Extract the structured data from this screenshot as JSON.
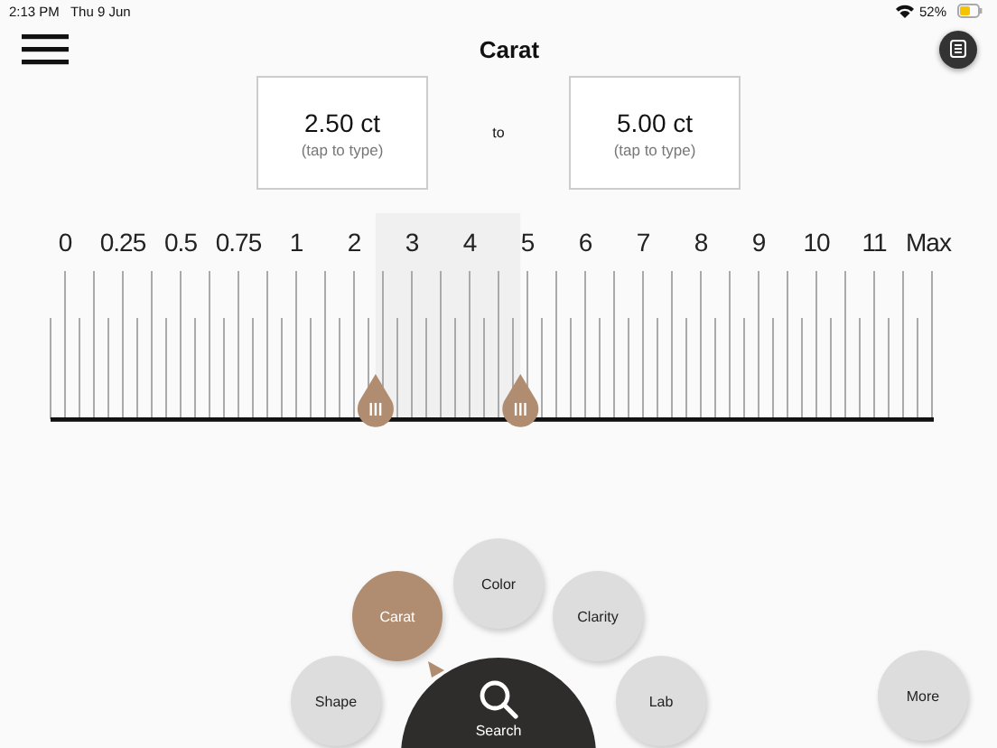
{
  "status_bar": {
    "time": "2:13 PM",
    "date": "Thu 9 Jun",
    "battery": "52%"
  },
  "title": "Carat",
  "range": {
    "from": {
      "value": "2.50 ct",
      "hint": "(tap to type)"
    },
    "separator": "to",
    "to": {
      "value": "5.00 ct",
      "hint": "(tap to type)"
    }
  },
  "scale": {
    "labels": [
      "0",
      "0.25",
      "0.5",
      "0.75",
      "1",
      "2",
      "3",
      "4",
      "5",
      "6",
      "7",
      "8",
      "9",
      "10",
      "11",
      "Max"
    ],
    "low_thumb": {
      "level": 0.368
    },
    "high_thumb": {
      "level": 0.532
    }
  },
  "filters": [
    {
      "label": "Carat",
      "selected": true
    },
    {
      "label": "Color",
      "selected": false
    },
    {
      "label": "Clarity",
      "selected": false
    },
    {
      "label": "Shape",
      "selected": false
    },
    {
      "label": "Lab",
      "selected": false
    }
  ],
  "search_button": {
    "label": "Search"
  },
  "more_button": {
    "label": "More"
  }
}
